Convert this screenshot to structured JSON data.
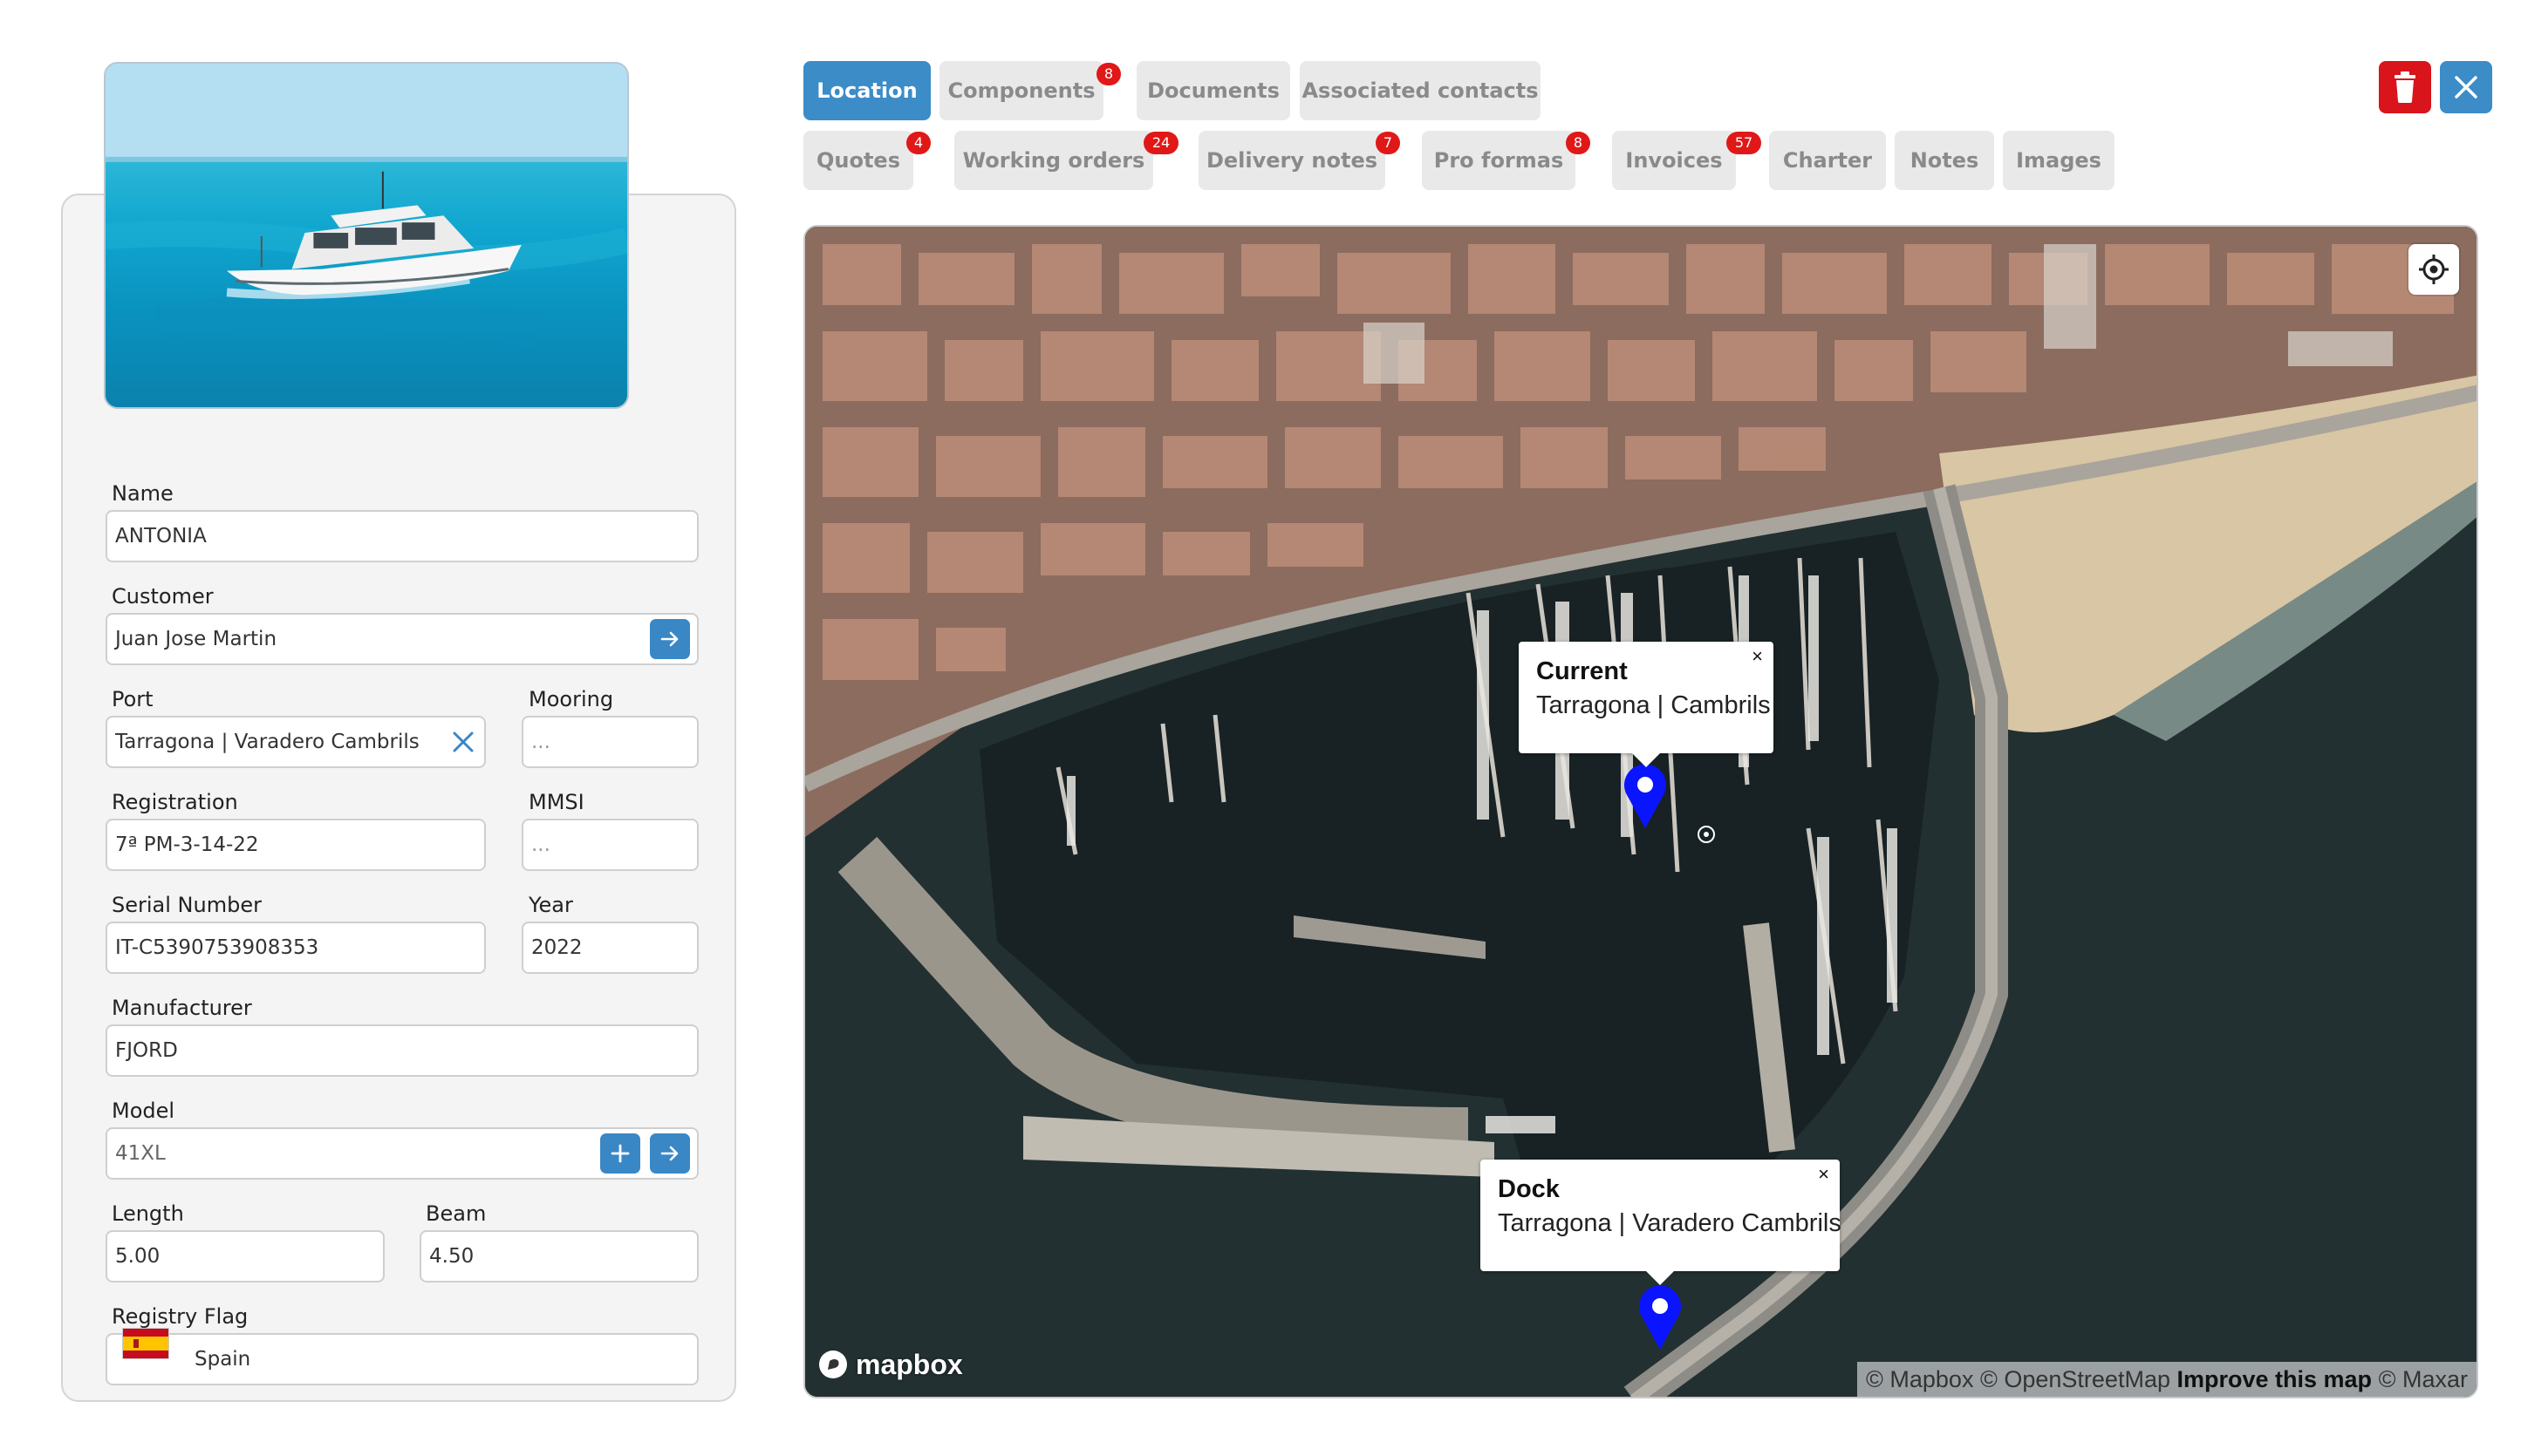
{
  "form": {
    "name_label": "Name",
    "name_value": "ANTONIA",
    "customer_label": "Customer",
    "customer_value": "Juan Jose Martin",
    "port_label": "Port",
    "port_value": "Tarragona | Varadero Cambrils",
    "mooring_label": "Mooring",
    "mooring_placeholder": "...",
    "registration_label": "Registration",
    "registration_value": "7ª PM-3-14-22",
    "mmsi_label": "MMSI",
    "mmsi_placeholder": "...",
    "serial_label": "Serial Number",
    "serial_value": "IT-C5390753908353",
    "year_label": "Year",
    "year_value": "2022",
    "manufacturer_label": "Manufacturer",
    "manufacturer_value": "FJORD",
    "model_label": "Model",
    "model_value": "41XL",
    "length_label": "Length",
    "length_value": "5.00",
    "beam_label": "Beam",
    "beam_value": "4.50",
    "flag_label": "Registry Flag",
    "flag_value": "Spain"
  },
  "tabs": [
    {
      "label": "Location",
      "active": true
    },
    {
      "label": "Components",
      "badge": "8"
    },
    {
      "label": "Documents"
    },
    {
      "label": "Associated contacts"
    },
    {
      "label": "Quotes",
      "badge": "4"
    },
    {
      "label": "Working orders",
      "badge": "24"
    },
    {
      "label": "Delivery notes",
      "badge": "7"
    },
    {
      "label": "Pro formas",
      "badge": "8"
    },
    {
      "label": "Invoices",
      "badge": "57"
    },
    {
      "label": "Charter"
    },
    {
      "label": "Notes"
    },
    {
      "label": "Images"
    }
  ],
  "actions": {
    "delete_color": "#d9141b",
    "close_color": "#3c8cc8",
    "delete_icon": "trash-icon",
    "close_icon": "close-icon"
  },
  "map": {
    "popup_current": {
      "title": "Current",
      "subtitle": "Tarragona | Cambrils",
      "close": "×"
    },
    "popup_dock": {
      "title": "Dock",
      "subtitle": "Tarragona | Varadero Cambrils",
      "close": "×"
    },
    "marker_color": "#0a14ff",
    "logo_text": "mapbox",
    "attribution": {
      "mapbox": "© Mapbox",
      "osm": "© OpenStreetMap",
      "improve": "Improve this map",
      "maxar": "© Maxar"
    }
  }
}
